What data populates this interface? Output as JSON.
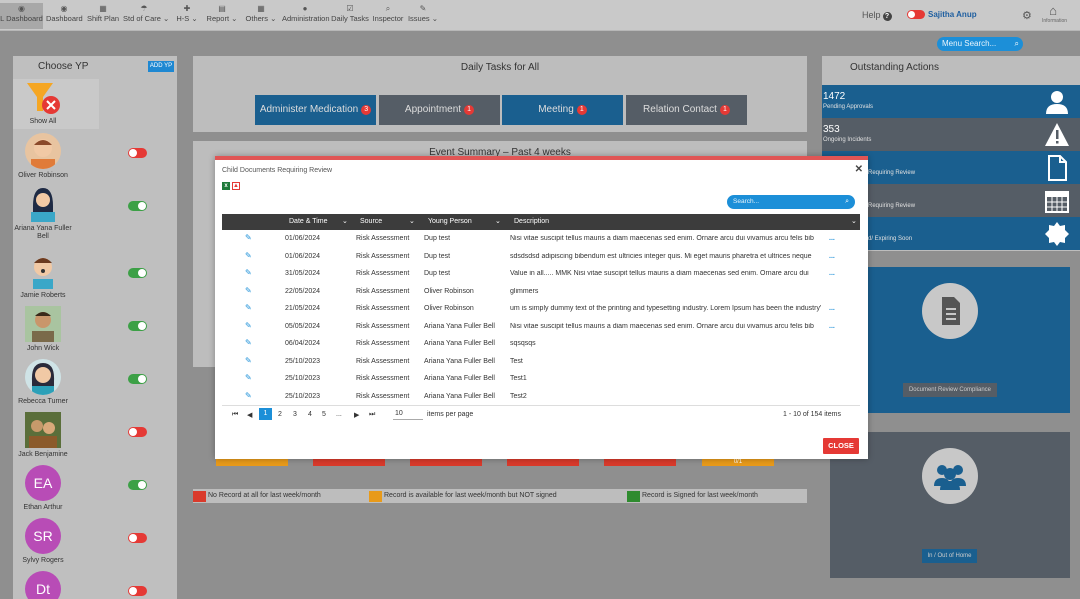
{
  "nav": {
    "items": [
      {
        "label": "L Dashboard",
        "icon": "dashboard-icon"
      },
      {
        "label": "Dashboard",
        "icon": "dashboard-icon"
      },
      {
        "label": "Shift Plan",
        "icon": "calendar-icon"
      },
      {
        "label": "Std of Care",
        "icon": "umbrella-icon"
      },
      {
        "label": "H-S",
        "icon": "plus-icon"
      },
      {
        "label": "Report",
        "icon": "report-icon"
      },
      {
        "label": "Others",
        "icon": "grid-icon"
      },
      {
        "label": "Administration",
        "icon": "user-icon"
      },
      {
        "label": "Daily Tasks",
        "icon": "tasks-icon"
      },
      {
        "label": "Inspector",
        "icon": "search-icon"
      },
      {
        "label": "Issues",
        "icon": "wrench-icon"
      }
    ],
    "help": "Help",
    "user": "Sajitha Anup",
    "home_label": "Information",
    "menu_search_placeholder": "Menu Search..."
  },
  "left": {
    "title": "Choose YP",
    "add_label": "ADD YP",
    "show_all": "Show All",
    "people": [
      {
        "name": "Oliver Robinson",
        "on": false
      },
      {
        "name": "Ariana Yana Fuller Bell",
        "on": true
      },
      {
        "name": "Jamie Roberts",
        "on": true
      },
      {
        "name": "John Wick",
        "on": true
      },
      {
        "name": "Rebecca Turner",
        "on": true
      },
      {
        "name": "Jack Benjamine",
        "on": false
      },
      {
        "name": "Ethan Arthur",
        "initials": "EA",
        "on": true
      },
      {
        "name": "Sylvy Rogers",
        "initials": "SR",
        "on": false
      },
      {
        "name": "",
        "initials": "Dt",
        "on": false
      }
    ]
  },
  "tasks": {
    "title": "Daily Tasks for All",
    "buttons": [
      {
        "label": "Administer Medication",
        "count": "3"
      },
      {
        "label": "Appointment",
        "count": "1"
      },
      {
        "label": "Meeting",
        "count": "1"
      },
      {
        "label": "Relation Contact",
        "count": "1"
      }
    ]
  },
  "events": {
    "title": "Event Summary – Past 4 weeks",
    "stub_label": "0/1"
  },
  "legend": {
    "red": "No Record at all for last week/month",
    "orange": "Record is available for last week/month but NOT signed",
    "green": "Record is Signed for last week/month"
  },
  "outstanding": {
    "title": "Outstanding Actions",
    "items": [
      {
        "count": "1472",
        "label": "Pending Approvals"
      },
      {
        "count": "353",
        "label": "Ongoing Incidents"
      },
      {
        "count": "",
        "label": "Requiring Review"
      },
      {
        "count": "",
        "label": "Requiring Review"
      },
      {
        "count": "",
        "label": "d/ Expiring Soon"
      }
    ]
  },
  "cards": {
    "doc_review": "Document Review Compliance",
    "in_out": "In / Out of Home"
  },
  "modal": {
    "title": "Child Documents Requiring Review",
    "search_placeholder": "Search...",
    "columns": {
      "date": "Date & Time",
      "source": "Source",
      "yp": "Young Person",
      "desc": "Description"
    },
    "rows": [
      {
        "date": "01/06/2024",
        "source": "Risk Assessment",
        "yp": "Dup test",
        "desc": "Nisi vitae suscipit tellus mauris a diam maecenas sed enim. Ornare arcu dui vivamus arcu felis bib",
        "more": true
      },
      {
        "date": "01/06/2024",
        "source": "Risk Assessment",
        "yp": "Dup test",
        "desc": "sdsdsdsd adipiscing bibendum est ultricies integer quis. Mi eget mauris pharetra et ultrices neque",
        "more": true
      },
      {
        "date": "31/05/2024",
        "source": "Risk Assessment",
        "yp": "Dup test",
        "desc": "Value in all..... MMK Nisi vitae suscipit tellus mauris a diam maecenas sed enim. Ornare arcu dui",
        "more": true
      },
      {
        "date": "22/05/2024",
        "source": "Risk Assessment",
        "yp": "Oliver Robinson",
        "desc": "glimmers",
        "more": false
      },
      {
        "date": "21/05/2024",
        "source": "Risk Assessment",
        "yp": "Oliver Robinson",
        "desc": "um is simply dummy text of the printing and typesetting industry. Lorem Ipsum has been the industry'",
        "more": true
      },
      {
        "date": "05/05/2024",
        "source": "Risk Assessment",
        "yp": "Ariana Yana Fuller Bell",
        "desc": "Nisi vitae suscipit tellus mauris a diam maecenas sed enim. Ornare arcu dui vivamus arcu felis bib",
        "more": true
      },
      {
        "date": "06/04/2024",
        "source": "Risk Assessment",
        "yp": "Ariana Yana Fuller Bell",
        "desc": "sqsqsqs",
        "more": false
      },
      {
        "date": "25/10/2023",
        "source": "Risk Assessment",
        "yp": "Ariana Yana Fuller Bell",
        "desc": "Test",
        "more": false
      },
      {
        "date": "25/10/2023",
        "source": "Risk Assessment",
        "yp": "Ariana Yana Fuller Bell",
        "desc": "Test1",
        "more": false
      },
      {
        "date": "25/10/2023",
        "source": "Risk Assessment",
        "yp": "Ariana Yana Fuller Bell",
        "desc": "Test2",
        "more": false
      }
    ],
    "more_label": "...",
    "pager": {
      "first": "⏮",
      "prev": "◀",
      "pages": [
        "1",
        "2",
        "3",
        "4",
        "5",
        "..."
      ],
      "next": "▶",
      "last": "⏭",
      "page_size": "10",
      "page_size_label": "items per page",
      "summary": "1 - 10 of 154 items"
    },
    "close_label": "CLOSE"
  }
}
